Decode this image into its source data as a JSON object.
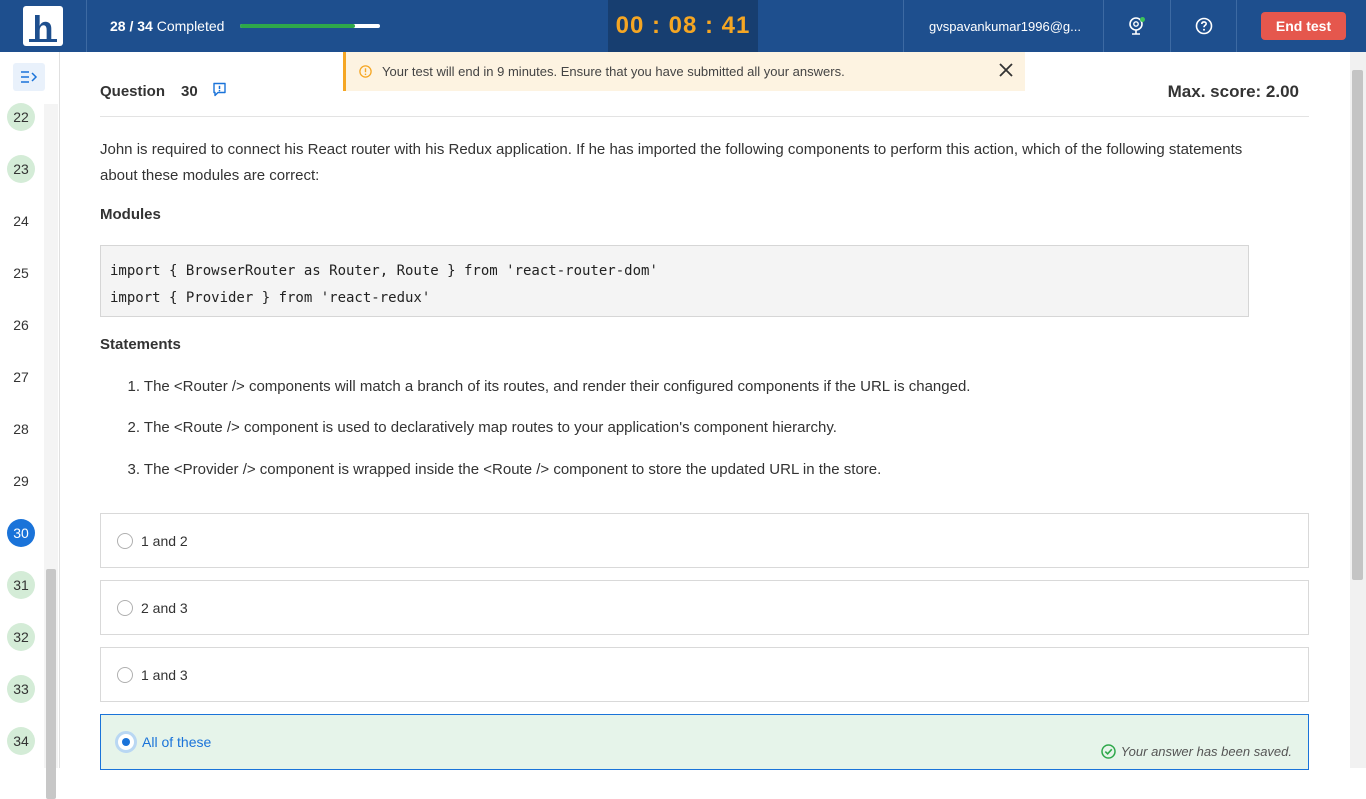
{
  "header": {
    "logo_letter": "h",
    "progress_count": "28 / 34",
    "progress_label": "Completed",
    "progress_fraction": 0.82,
    "timer": "00 : 08 : 41",
    "user_email": "gvspavankumar1996@g...",
    "end_test_label": "End test"
  },
  "alert": {
    "message": "Your test will end in 9 minutes. Ensure that you have submitted all your answers."
  },
  "sidebar": {
    "questions": [
      {
        "num": "22",
        "status": "answered"
      },
      {
        "num": "23",
        "status": "answered"
      },
      {
        "num": "24",
        "status": "unanswered"
      },
      {
        "num": "25",
        "status": "unanswered"
      },
      {
        "num": "26",
        "status": "unanswered"
      },
      {
        "num": "27",
        "status": "unanswered"
      },
      {
        "num": "28",
        "status": "unanswered"
      },
      {
        "num": "29",
        "status": "unanswered"
      },
      {
        "num": "30",
        "status": "current"
      },
      {
        "num": "31",
        "status": "answered"
      },
      {
        "num": "32",
        "status": "answered"
      },
      {
        "num": "33",
        "status": "answered"
      },
      {
        "num": "34",
        "status": "answered"
      }
    ]
  },
  "question": {
    "label": "Question",
    "number": "30",
    "max_score": "Max. score: 2.00",
    "text": "John is required to connect his React router with his Redux application. If he has imported the following components to perform this action, which of the following statements about these modules are correct:",
    "modules_heading": "Modules",
    "code_lines": [
      "import { BrowserRouter as Router, Route } from 'react-router-dom'",
      "import { Provider } from 'react-redux'"
    ],
    "statements_heading": "Statements",
    "statements": [
      {
        "n": "1.",
        "text": "The <Router /> components will match a branch of its routes, and render their configured components if the URL is changed."
      },
      {
        "n": "2.",
        "text": "The <Route /> component is used to declaratively map routes to your application's component hierarchy."
      },
      {
        "n": "3.",
        "text": "The <Provider /> component is wrapped inside the <Route /> component to store the updated URL in the store."
      }
    ],
    "options": [
      {
        "label": "1 and 2",
        "selected": false
      },
      {
        "label": "2 and 3",
        "selected": false
      },
      {
        "label": "1 and 3",
        "selected": false
      },
      {
        "label": "All of these",
        "selected": true
      }
    ],
    "saved_message": "Your answer has been saved."
  },
  "colors": {
    "header_bg": "#1e4f8e",
    "timer_bg": "#173e70",
    "timer_text": "#f5a623",
    "end_button": "#e5574d",
    "accent": "#1a73d9",
    "answered_bg": "#d4ecd7"
  }
}
